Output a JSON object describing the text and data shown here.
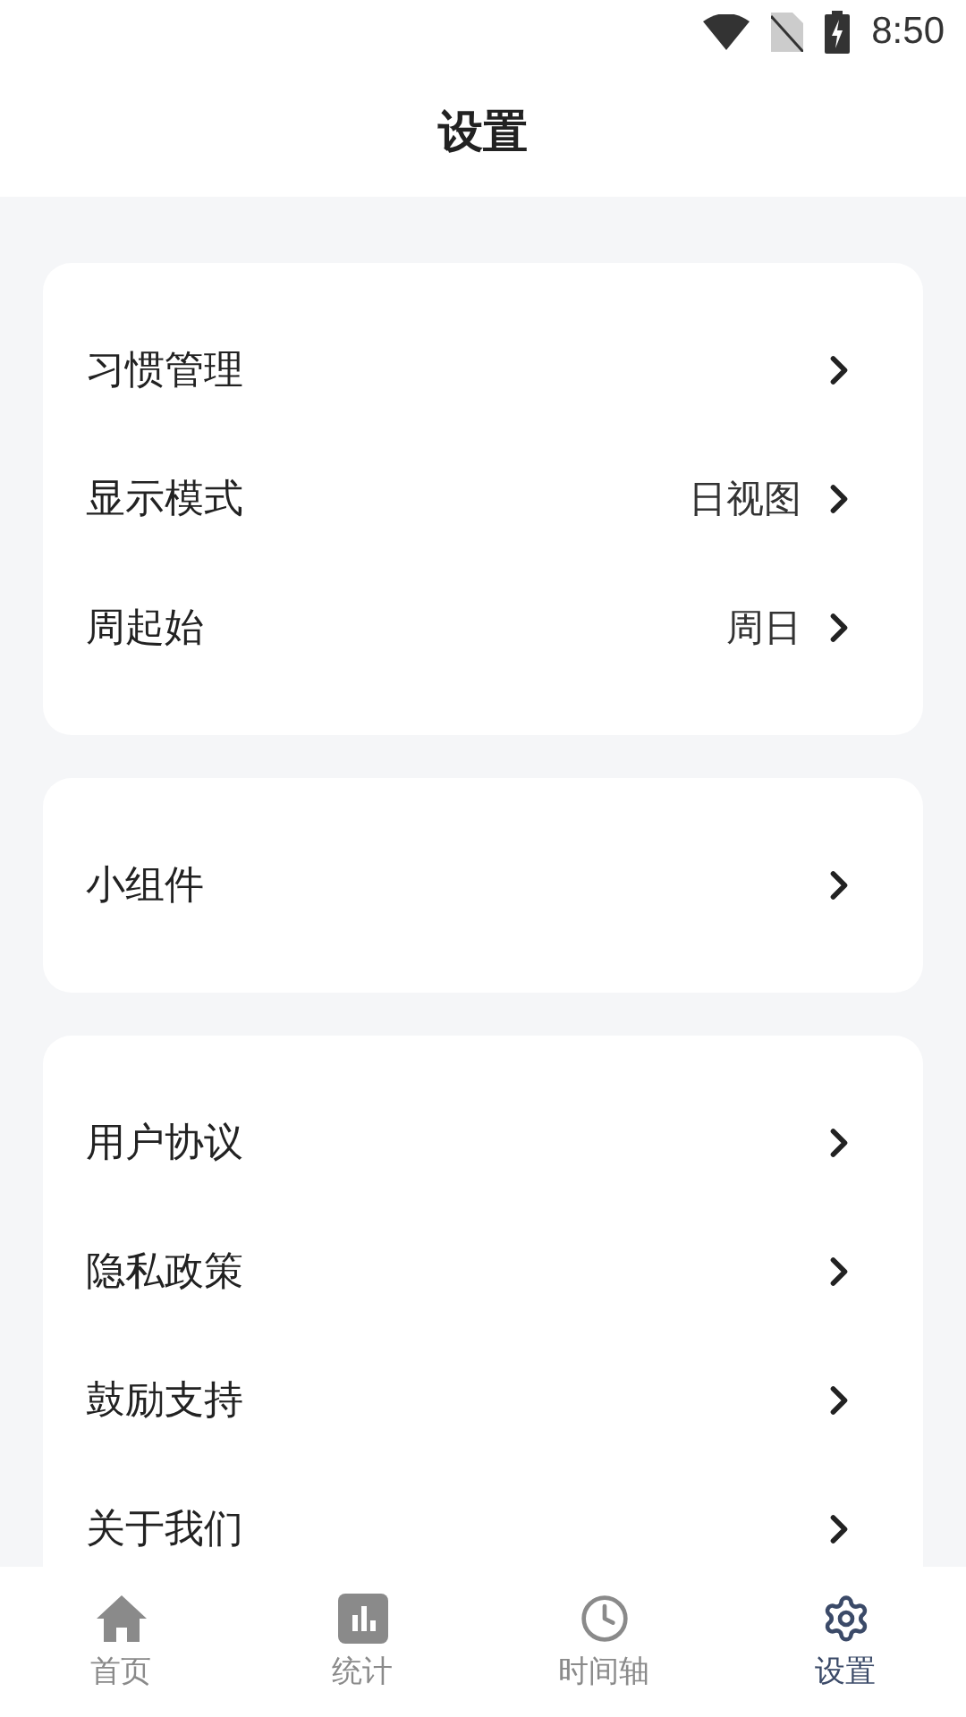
{
  "status_bar": {
    "time": "8:50"
  },
  "header": {
    "title": "设置"
  },
  "groups": [
    {
      "items": [
        {
          "label": "习惯管理"
        },
        {
          "label": "显示模式",
          "value": "日视图"
        },
        {
          "label": "周起始",
          "value": "周日"
        }
      ]
    },
    {
      "items": [
        {
          "label": "小组件"
        }
      ]
    },
    {
      "items": [
        {
          "label": "用户协议"
        },
        {
          "label": "隐私政策"
        },
        {
          "label": "鼓励支持"
        },
        {
          "label": "关于我们"
        }
      ]
    }
  ],
  "tab_bar": [
    {
      "label": "首页",
      "kind": "home",
      "selected": false
    },
    {
      "label": "统计",
      "kind": "stats",
      "selected": false
    },
    {
      "label": "时间轴",
      "kind": "timeline",
      "selected": false
    },
    {
      "label": "设置",
      "kind": "settings",
      "selected": true
    }
  ]
}
